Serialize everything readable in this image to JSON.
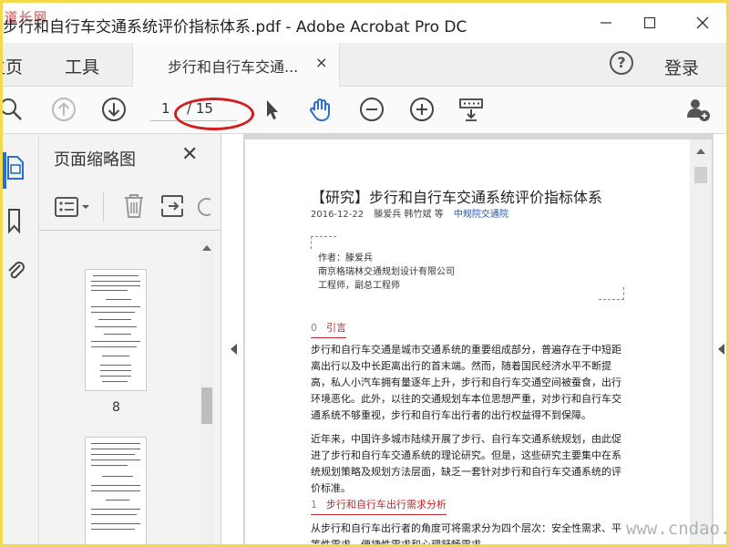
{
  "window": {
    "logo_text": "道长网",
    "title": "步行和自行车交通系统评价指标体系.pdf - Adobe Acrobat Pro DC",
    "minimize_icon": "minimize-icon",
    "maximize_icon": "maximize-icon",
    "close_icon": "close-icon"
  },
  "tabs": {
    "home": "主页",
    "tools": "工具",
    "document": "步行和自行车交通...",
    "close_glyph": "×",
    "help_glyph": "?",
    "login": "登录"
  },
  "toolbar": {
    "page_current": "1",
    "page_total": "/ 15",
    "icons": [
      "search-icon",
      "prev-page-icon",
      "next-page-icon",
      "select-cursor-icon",
      "hand-tool-icon",
      "zoom-out-icon",
      "zoom-in-icon",
      "page-display-icon",
      "add-user-icon"
    ]
  },
  "thumbnail_panel": {
    "title": "页面缩略图",
    "close_glyph": "✕",
    "pages": [
      {
        "label": "8"
      },
      {
        "label": ""
      }
    ]
  },
  "document": {
    "title": "【研究】步行和自行车交通系统评价指标体系",
    "date": "2016-12-22",
    "authors": "滕爱兵 韩竹斌 等",
    "source": "中规院交通院",
    "author_lines": [
      "作者：滕爱兵",
      "南京格瑞林交通规划设计有限公司",
      "工程师，副总工程师"
    ],
    "section0_num": "0",
    "section0_title": "引言",
    "para1": "步行和自行车交通是城市交通系统的重要组成部分，普遍存在于中短距离出行以及中长距离出行的首末端。然而，随着国民经济水平不断提高，私人小汽车拥有量逐年上升，步行和自行车交通空间被蚕食，出行环境恶化。此外，以往的交通规划车本位思想严重，对步行和自行车交通系统不够重视，步行和自行车出行者的出行权益得不到保障。",
    "para2": "近年来，中国许多城市陆续开展了步行、自行车交通系统规划，由此促进了步行和自行车交通系统的理论研究。但是，这些研究主要集中在系统规划策略及规划方法层面，缺乏一套针对步行和自行车交通系统的评价标准。",
    "section1_num": "1",
    "section1_title": "步行和自行车出行需求分析",
    "para3": "从步行和自行车出行者的角度可将需求分为四个层次：安全性需求、平等性需求、便捷性需求和心理舒畅需求。"
  },
  "watermark": "www.cndao.com",
  "colors": {
    "frame_border": "#f3d94c",
    "annotation_red": "#d21f1f",
    "hand_tool_blue": "#2a6fc9",
    "section_red": "#c0262b"
  }
}
